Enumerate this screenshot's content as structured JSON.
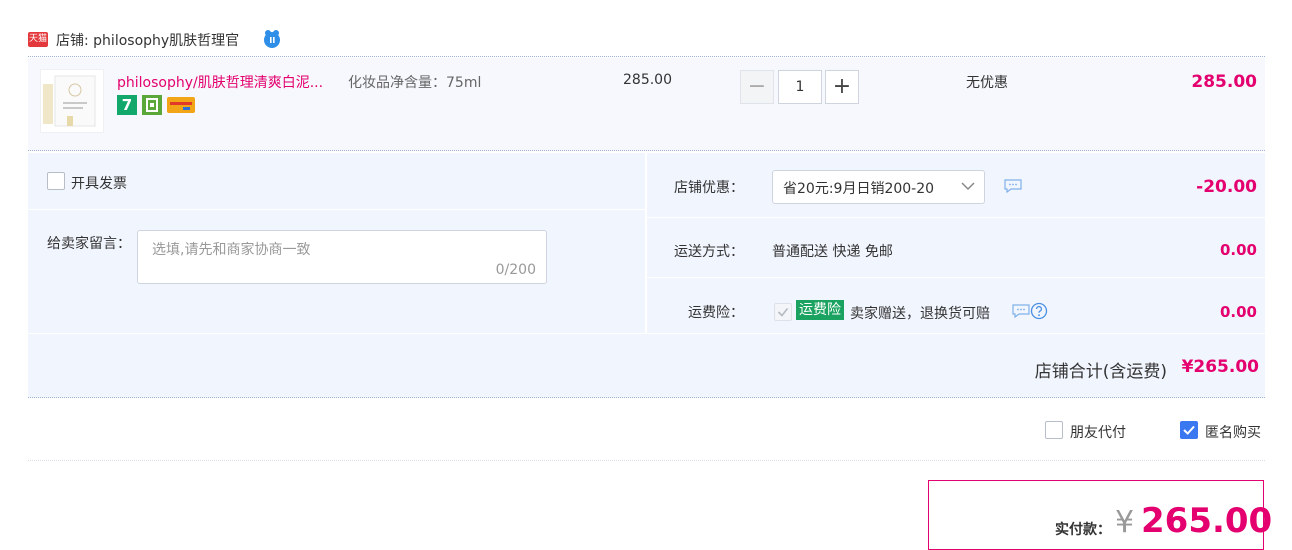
{
  "shop": {
    "badge": "天猫",
    "label": "店铺: philosophy肌肤哲理官",
    "ww_icon": "wangwang-chat-icon"
  },
  "item": {
    "title": "philosophy/肌肤哲理清爽白泥...",
    "sku": "化妆品净含量：75ml",
    "badge_7": "7",
    "unit_price": "285.00",
    "quantity": "1",
    "minus": "−",
    "plus": "+",
    "promotion": "无优惠",
    "total": "285.00"
  },
  "invoice": {
    "label": "开具发票"
  },
  "message": {
    "label": "给卖家留言：",
    "placeholder": "选填,请先和商家协商一致",
    "count": "0/200"
  },
  "coupon": {
    "label": "店铺优惠：",
    "selected": "省20元:9月日销200-20",
    "amount": "-20.00"
  },
  "shipping": {
    "label": "运送方式：",
    "value": "普通配送 快递 免邮",
    "amount": "0.00"
  },
  "insurance": {
    "label": "运费险：",
    "tag": "运费险",
    "text": "卖家赠送，退换货可赔",
    "amount": "0.00"
  },
  "store_total": {
    "label": "店铺合计(含运费)",
    "value": "¥265.00"
  },
  "options": {
    "friend_pay": "朋友代付",
    "anonymous": "匿名购买",
    "anonymous_checked": true
  },
  "payment": {
    "label": "实付款：",
    "currency": "¥",
    "amount": "265.00"
  },
  "colors": {
    "accent": "#e4006e",
    "tag_green": "#1aa260",
    "checkbox_blue": "#3a78f2",
    "panel_bg": "#f1f5fe"
  }
}
